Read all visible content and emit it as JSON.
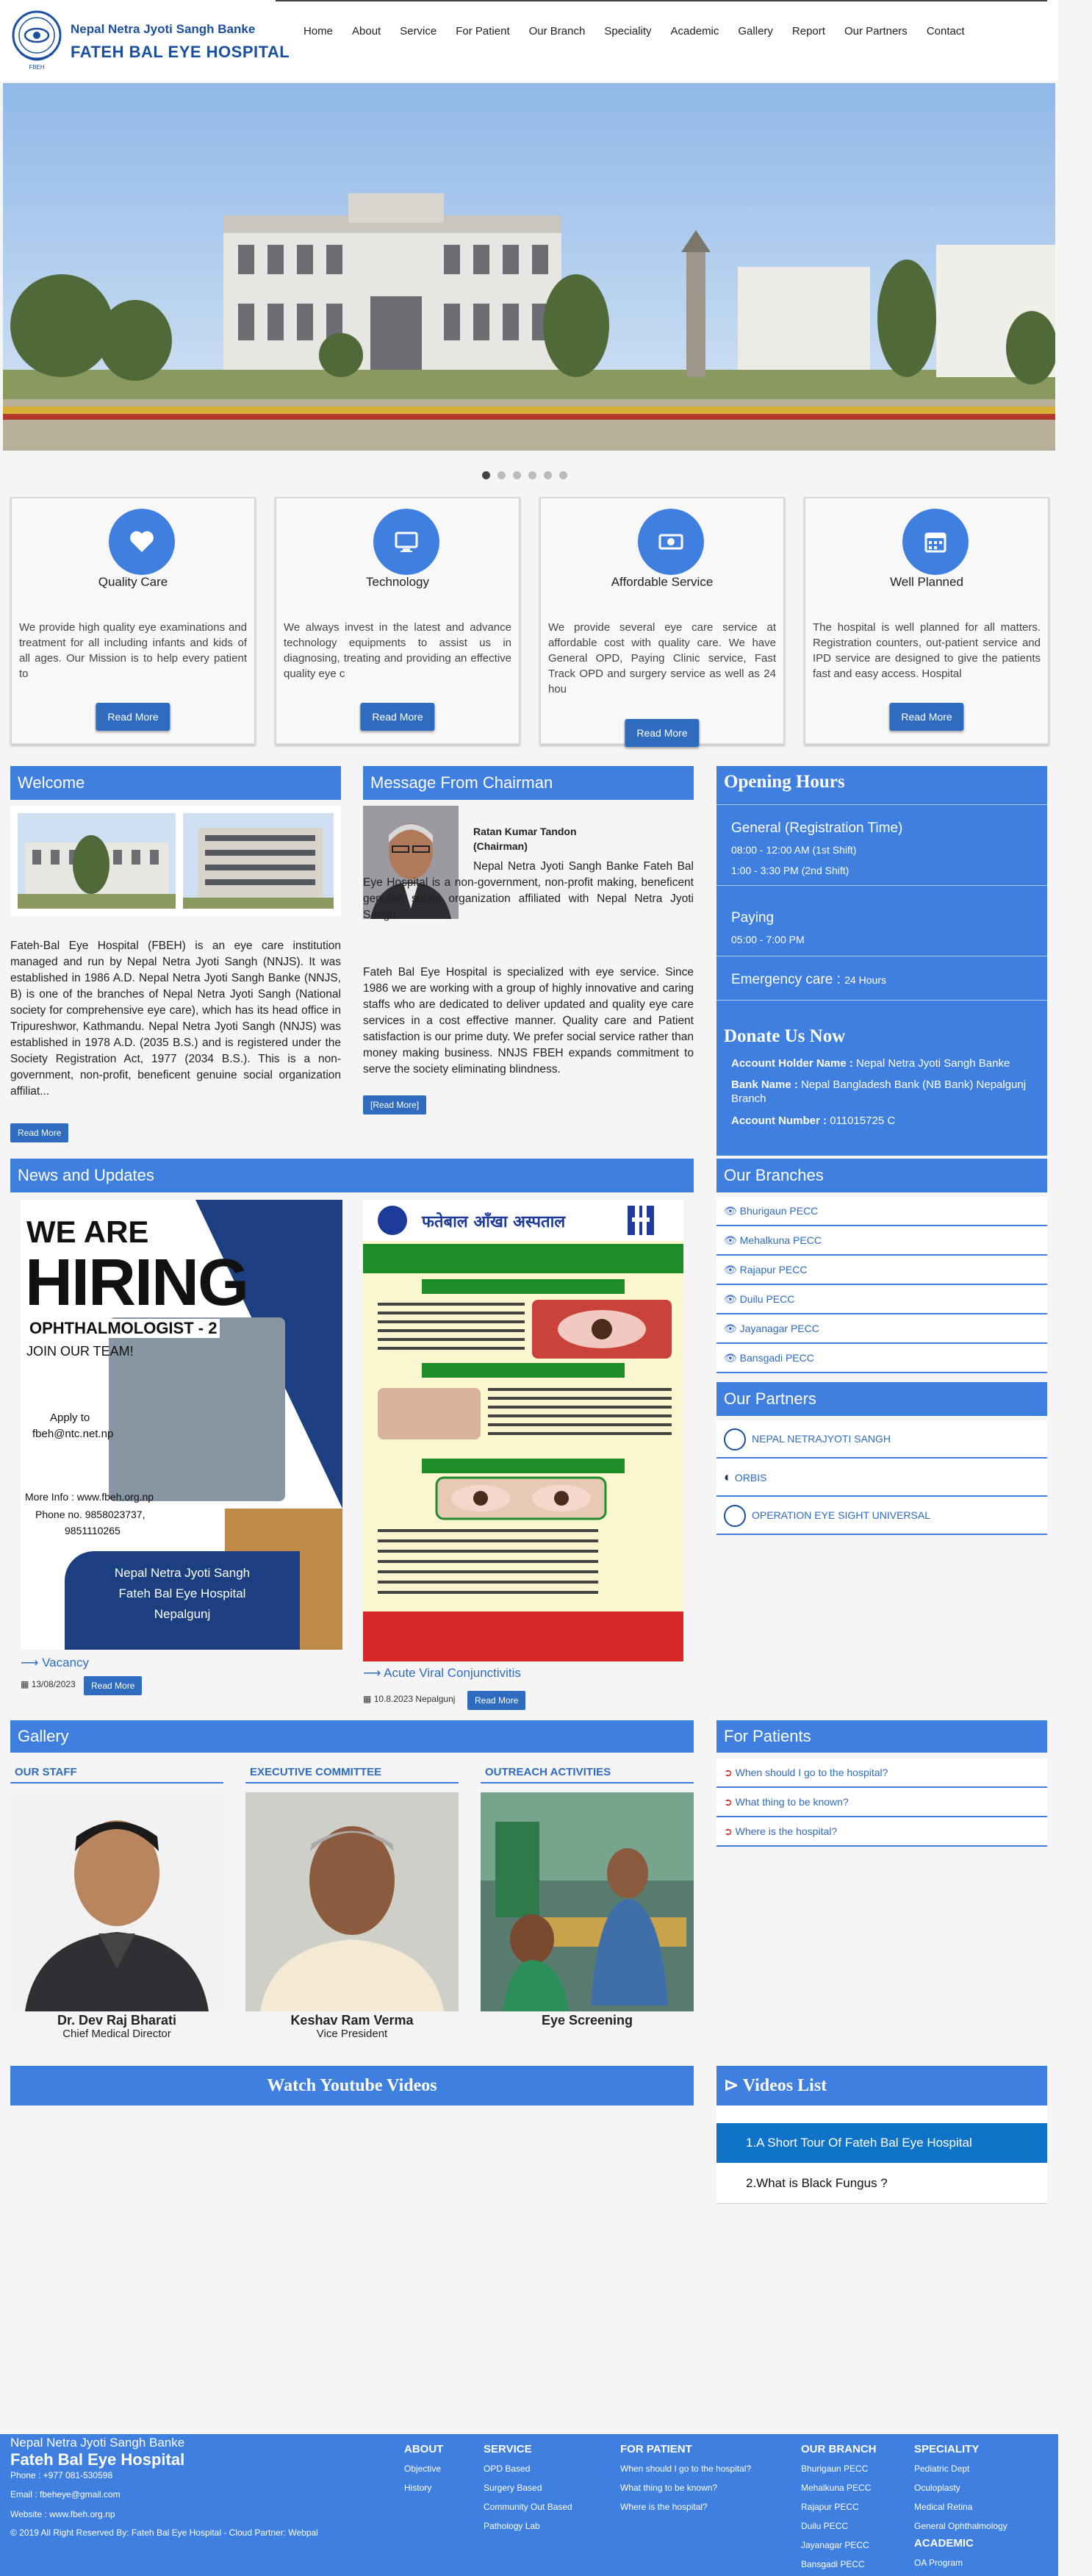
{
  "brand": {
    "line1": "Nepal Netra Jyoti Sangh Banke",
    "line2": "FATEH BAL EYE HOSPITAL"
  },
  "nav": [
    "Home",
    "About",
    "Service",
    "For Patient",
    "Our Branch",
    "Speciality",
    "Academic",
    "Gallery",
    "Report",
    "Our Partners",
    "Contact"
  ],
  "carousel": {
    "slides": 6,
    "active": 0
  },
  "features": [
    {
      "icon": "heart-icon",
      "title": "Quality Care",
      "text": "We provide high quality eye examinations and treatment for all including infants and kids of all ages. Our Mission is to help every patient to",
      "button": "Read More"
    },
    {
      "icon": "monitor-icon",
      "title": "Technology",
      "text": "We always invest in the latest and advance technology equipments to assist us in diagnosing, treating and providing an effective quality eye c",
      "button": "Read More"
    },
    {
      "icon": "money-icon",
      "title": "Affordable Service",
      "text": "We provide several eye care service at affordable cost with quality care. We have General OPD, Paying Clinic service, Fast Track OPD and surgery service as well as 24 hou",
      "button": "Read More"
    },
    {
      "icon": "calendar-icon",
      "title": "Well Planned",
      "text": "The hospital is well planned for all matters. Registration counters, out-patient service and IPD service are designed to give the patients fast and easy access. Hospital",
      "button": "Read More"
    }
  ],
  "welcome": {
    "title": "Welcome",
    "text": "Fateh-Bal Eye Hospital (FBEH) is an eye care institution managed and run by Nepal Netra Jyoti Sangh (NNJS). It was established in 1986 A.D. Nepal Netra Jyoti Sangh Banke (NNJS, B) is one of the branches of Nepal Netra Jyoti Sangh (National society for comprehensive eye care), which has its head office in Tripureshwor, Kathmandu. Nepal Netra Jyoti Sangh (NNJS) was established in 1978 A.D. (2035 B.S.) and is registered under the Society Registration Act, 1977 (2034 B.S.). This is a non-government, non-profit, beneficent genuine social organization affiliat...",
    "button": "Read More"
  },
  "chairman": {
    "title": "Message From Chairman",
    "name": "Ratan Kumar Tandon",
    "role": "(Chairman)",
    "text1": "Nepal Netra Jyoti Sangh Banke Fateh Bal Eye Hospital is a non-government, non-profit making, beneficent genuine social organization affiliated with Nepal Netra Jyoti Sangh.",
    "text2": "Fateh Bal Eye Hospital is specialized with eye service. Since 1986 we are working with a group of highly innovative and caring staffs who are dedicated to deliver updated and quality eye care services in a cost effective manner. Quality care and Patient satisfaction is our prime duty. We prefer social service rather than money making business. NNJS FBEH expands commitment to serve the society eliminating blindness.",
    "button": "[Read More]"
  },
  "opening": {
    "title": "Opening Hours",
    "general_label": "General (Registration Time)",
    "shift1": "08:00 - 12:00 AM (1st Shift)",
    "shift2": "1:00 - 3:30 PM (2nd Shift)",
    "paying_label": "Paying",
    "paying_time": "05:00 - 7:00 PM",
    "emergency_label": "Emergency care :",
    "emergency_time": "24 Hours"
  },
  "donate": {
    "title": "Donate Us Now",
    "holder_label": "Account Holder Name :",
    "holder": "Nepal Netra Jyoti Sangh Banke",
    "bank_label": "Bank Name :",
    "bank": "Nepal Bangladesh Bank (NB Bank) Nepalgunj Branch",
    "number_label": "Account Number :",
    "number": "011015725 C"
  },
  "news": {
    "title": "News and Updates",
    "items": [
      {
        "title": "Vacancy",
        "date": "13/08/2023",
        "button": "Read More"
      },
      {
        "title": "Acute Viral Conjunctivitis",
        "date": "10.8.2023 Nepalgunj",
        "button": "Read More"
      }
    ],
    "hiring": {
      "l1": "WE ARE",
      "l2": "HIRING",
      "l3": "OPHTHALMOLOGIST - 2",
      "l4": "JOIN OUR TEAM!",
      "apply": "Apply to",
      "email": "fbeh@ntc.net.np",
      "more": "More Info : www.fbeh.org.np",
      "phone": "Phone no. 9858023737,",
      "phone2": "9851110265",
      "org1": "Nepal Netra Jyoti Sangh",
      "org2": "Fateh Bal Eye Hospital",
      "org3": "Nepalgunj"
    },
    "conj": {
      "heading": "फतेबाल आँखा अस्पताल"
    }
  },
  "branches": {
    "title": "Our Branches",
    "items": [
      "Bhurigaun PECC",
      "Mehalkuna PECC",
      "Rajapur PECC",
      "Duilu PECC",
      "Jayanagar PECC",
      "Bansgadi PECC"
    ]
  },
  "partners": {
    "title": "Our Partners",
    "items": [
      "NEPAL NETRAJYOTI SANGH",
      "ORBIS",
      "OPERATION EYE SIGHT UNIVERSAL"
    ]
  },
  "gallery": {
    "title": "Gallery",
    "groups": [
      {
        "caption": "OUR STAFF",
        "name": "Dr. Dev Raj Bharati",
        "role": "Chief Medical Director"
      },
      {
        "caption": "EXECUTIVE COMMITTEE",
        "name": "Keshav Ram Verma",
        "role": "Vice President"
      },
      {
        "caption": "OUTREACH ACTIVITIES",
        "name": "Eye Screening",
        "role": ""
      }
    ]
  },
  "patients": {
    "title": "For Patients",
    "items": [
      "When should I go to the hospital?",
      "What thing to be known?",
      "Where is the hospital?"
    ]
  },
  "youtube": {
    "title": "Watch Youtube Videos"
  },
  "videos": {
    "title": "Videos List",
    "items": [
      "1.A Short Tour Of Fateh Bal Eye Hospital",
      "2.What is Black Fungus ?"
    ]
  },
  "footer": {
    "org": "Nepal Netra Jyoti Sangh Banke",
    "name": "Fateh Bal Eye Hospital",
    "phone": "Phone : +977 081-530598",
    "email": "Email : fbeheye@gmail.com",
    "website": "Website : www.fbeh.org.np",
    "copyright": "© 2019 All Right Reserved By: Fateh Bal Eye Hospital - Cloud Partner: Webpal",
    "about": {
      "title": "ABOUT",
      "items": [
        "Objective",
        "History"
      ]
    },
    "service": {
      "title": "SERVICE",
      "items": [
        "OPD Based",
        "Surgery Based",
        "Community Out Based",
        "Pathology Lab"
      ]
    },
    "patient": {
      "title": "FOR PATIENT",
      "items": [
        "When should I go to the hospital?",
        "What thing to be known?",
        "Where is the hospital?"
      ]
    },
    "branch": {
      "title": "OUR BRANCH",
      "items": [
        "Bhurigaun PECC",
        "Mehalkuna PECC",
        "Rajapur PECC",
        "Duilu PECC",
        "Jayanagar PECC",
        "Bansgadi PECC"
      ]
    },
    "speciality": {
      "title": "SPECIALITY",
      "items": [
        "Pediatric Dept",
        "Oculoplasty",
        "Medical Retina",
        "General Ophthalmology"
      ]
    },
    "academic": {
      "title": "ACADEMIC",
      "items": [
        "OA Program"
      ]
    }
  },
  "colors": {
    "primary": "#3f7fe0",
    "button": "#2f6bbf",
    "brand": "#1b4fa0"
  }
}
